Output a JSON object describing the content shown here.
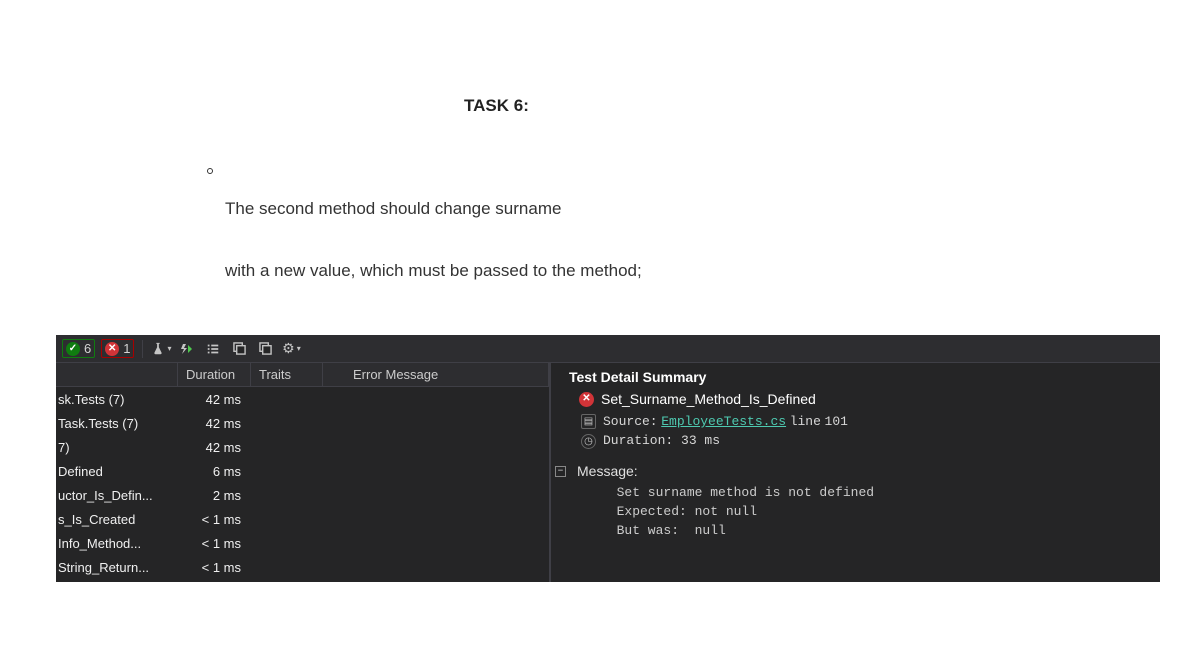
{
  "document": {
    "heading": "TASK 6:",
    "bullet_line1": "The second method should change  surname",
    "bullet_line2": "with a new value, which must be passed to the method;"
  },
  "toolbar": {
    "pass_count": "6",
    "fail_count": "1"
  },
  "list_header": {
    "duration": "Duration",
    "traits": "Traits",
    "error_message": "Error Message"
  },
  "rows": [
    {
      "name": "sk.Tests (7)",
      "duration": "42 ms"
    },
    {
      "name": "Task.Tests (7)",
      "duration": "42 ms"
    },
    {
      "name": "7)",
      "duration": "42 ms"
    },
    {
      "name": "Defined",
      "duration": "6 ms"
    },
    {
      "name": "uctor_Is_Defin...",
      "duration": "2 ms"
    },
    {
      "name": "s_Is_Created",
      "duration": "< 1 ms"
    },
    {
      "name": "Info_Method...",
      "duration": "< 1 ms"
    },
    {
      "name": "String_Return...",
      "duration": "< 1 ms"
    }
  ],
  "detail": {
    "heading": "Test Detail Summary",
    "test_name": "Set_Surname_Method_Is_Defined",
    "source_label": "Source:",
    "source_link": "EmployeeTests.cs",
    "source_line_label": "line",
    "source_line_num": "101",
    "duration_label": "Duration:",
    "duration_value": "33 ms",
    "message_label": "Message:",
    "message_body": "  Set surname method is not defined\n  Expected: not null\n  But was:  null"
  },
  "icons": {
    "pass_check": "✓",
    "fail_x": "✕",
    "caret_down": "▾",
    "lightning": "⚡",
    "playlist": "≔",
    "windows1": "❐",
    "windows2": "❐",
    "gear": "⚙",
    "document": "▤",
    "clock": "◷",
    "minus": "−"
  }
}
